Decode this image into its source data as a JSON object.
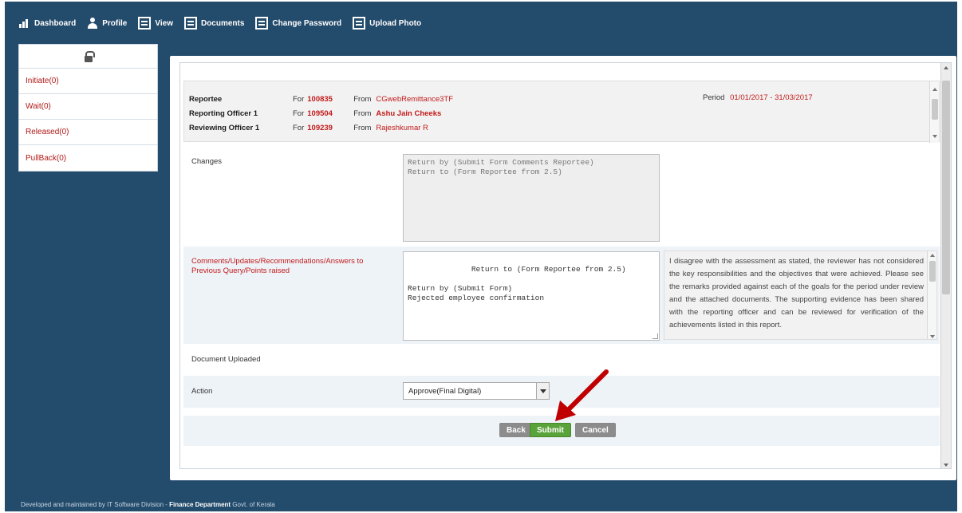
{
  "nav": {
    "items": [
      {
        "label": "Dashboard",
        "icon": "bar-chart-icon"
      },
      {
        "label": "Profile",
        "icon": "person-icon"
      },
      {
        "label": "View",
        "icon": "document-icon"
      },
      {
        "label": "Documents",
        "icon": "document-icon"
      },
      {
        "label": "Change Password",
        "icon": "document-icon"
      },
      {
        "label": "Upload Photo",
        "icon": "document-icon"
      }
    ]
  },
  "sidebar": {
    "items": [
      {
        "label": "Initiate(0)"
      },
      {
        "label": "Wait(0)"
      },
      {
        "label": "Released(0)"
      },
      {
        "label": "PullBack(0)"
      }
    ]
  },
  "info": {
    "reportee": {
      "label": "Reportee",
      "for": "For",
      "code": "100835",
      "from": "From",
      "name": "CGwebRemittance3TF"
    },
    "reporting": {
      "label": "Reporting Officer 1",
      "for": "For",
      "code": "109504",
      "from": "From",
      "name": "Ashu Jain Cheeks"
    },
    "reviewing": {
      "label": "Reviewing Officer 1",
      "for": "For",
      "code": "109239",
      "from": "From",
      "name": "Rajeshkumar R"
    },
    "period": {
      "label": "Period",
      "value": "01/01/2017 - 31/03/2017"
    }
  },
  "form": {
    "changes": {
      "label": "Changes",
      "value": "Return by (Submit Form Comments Reportee)\nReturn to (Form Reportee from 2.5)"
    },
    "comments": {
      "label": "Comments/Updates/Recommendations/Answers to Previous Query/Points raised",
      "value": "Return to (Form Reportee from 2.5)\n\nReturn by (Submit Form)\nRejected employee confirmation",
      "note": "I disagree with the assessment as stated, the reviewer has not considered the key responsibilities and the objectives that were achieved. Please see the remarks provided against each of the goals for the period under review and the attached documents. The supporting evidence has been shared with the reporting officer and can be reviewed for verification of the achievements listed in this report."
    },
    "document": {
      "label": "Document Uploaded"
    },
    "action": {
      "label": "Action",
      "selected": "Approve(Final Digital)"
    }
  },
  "buttons": {
    "back": "Back",
    "submit": "Submit",
    "cancel": "Cancel"
  },
  "footer": {
    "text": "Developed and maintained by IT Software Division - ",
    "bold": "Finance Department",
    "tail": " Govt. of Kerala"
  },
  "colors": {
    "header": "#234b6b",
    "accent_red": "#c21a1a",
    "submit_green": "#5aa23a",
    "annotation_arrow": "#c00000"
  }
}
